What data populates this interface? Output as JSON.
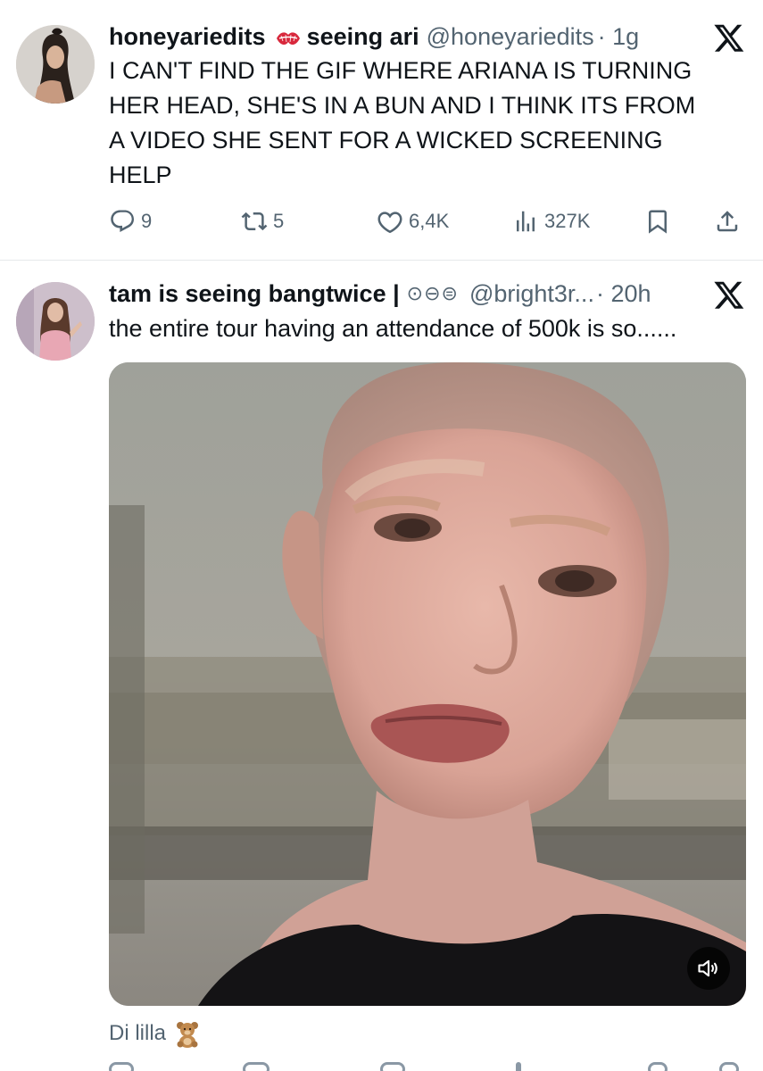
{
  "tweets": [
    {
      "display_name": "honeyariedits",
      "display_name_suffix": "seeing ari",
      "handle": "@honeyariedits",
      "time": "· 1g",
      "text": "I CAN'T FIND THE GIF WHERE ARIANA IS TURNING\nHER HEAD, SHE'S IN A BUN AND I THINK ITS FROM\nA VIDEO SHE SENT FOR A  WICKED SCREENING\nHELP",
      "stats": {
        "replies": "9",
        "reposts": "5",
        "likes": "6,4K",
        "views": "327K"
      }
    },
    {
      "display_name": "tam is seeing bangtwice |",
      "badges": "⊙⊖⊜",
      "handle": "@bright3r...",
      "time": "· 20h",
      "text": "the entire tour having an attendance of 500k is so......",
      "caption": "Di lilla"
    }
  ],
  "icons": {
    "brand": "x-logo-icon",
    "reply": "reply-icon",
    "repost": "repost-icon",
    "like": "heart-icon",
    "views": "views-icon",
    "bookmark": "bookmark-icon",
    "share": "share-icon",
    "mute": "speaker-muted-icon",
    "emoji_kiss": "kiss-mark-emoji",
    "emoji_bear": "teddy-bear-emoji"
  },
  "colors": {
    "text": "#0f1419",
    "muted": "#536471",
    "divider": "#e6e9eb",
    "kiss_red": "#d8283c"
  }
}
